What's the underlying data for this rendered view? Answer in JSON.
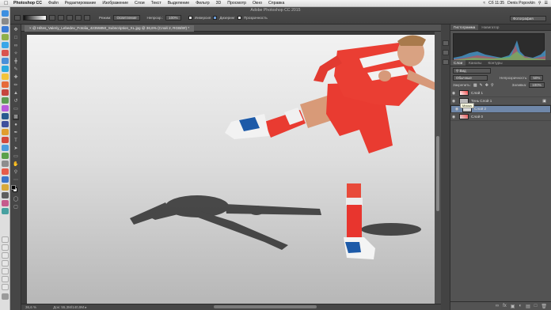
{
  "menubar": {
    "app_name": "Photoshop CC",
    "items": [
      "Файл",
      "Редактирование",
      "Изображение",
      "Слои",
      "Текст",
      "Выделение",
      "Фильтр",
      "3D",
      "Просмотр",
      "Окно",
      "Справка"
    ],
    "clock": "Сб 11:35",
    "user": "Denis Popovkin"
  },
  "window": {
    "title": "Adobe Photoshop CC 2015"
  },
  "options": {
    "mode_label": "Режим:",
    "mode_value": "Осветление",
    "opacity_label": "Непрозр.:",
    "opacity_value": "100%",
    "invert_label": "Инверсия",
    "dither_label": "Дизеринг",
    "transparency_label": "Прозрачность",
    "workspace": "Фотография"
  },
  "document": {
    "tab_title": "@ Hiltes_Valeriy_Lebedev_Fotolia_42355850_Subscription_XL.jpg @ 36,6% (Слой 2, RGB/8#) *",
    "zoom": "36,6 %",
    "doc_size": "Док: 55,3M/140,9M"
  },
  "panels": {
    "top_tabs": [
      "Гистограмма",
      "Навигатор"
    ],
    "layer_tabs": [
      "Слои",
      "Каналы",
      "Контуры"
    ],
    "kind_label": "Вид",
    "blend_mode": "Обычные",
    "opacity_label": "Непрозрачность:",
    "opacity_value": "50%",
    "lock_label": "Закрепить:",
    "fill_label": "Заливка:",
    "fill_value": "100%",
    "layers": [
      {
        "name": "Слой 1",
        "selected": false
      },
      {
        "name": "Тень Слой 1",
        "selected": false
      },
      {
        "name": "Слой 2",
        "selected": true
      },
      {
        "name": "Слой 0",
        "selected": false
      }
    ],
    "tooltip": "Маска"
  },
  "colors": {
    "accent_selected_layer": "#6f87a9",
    "kit_red": "#e8312c"
  }
}
